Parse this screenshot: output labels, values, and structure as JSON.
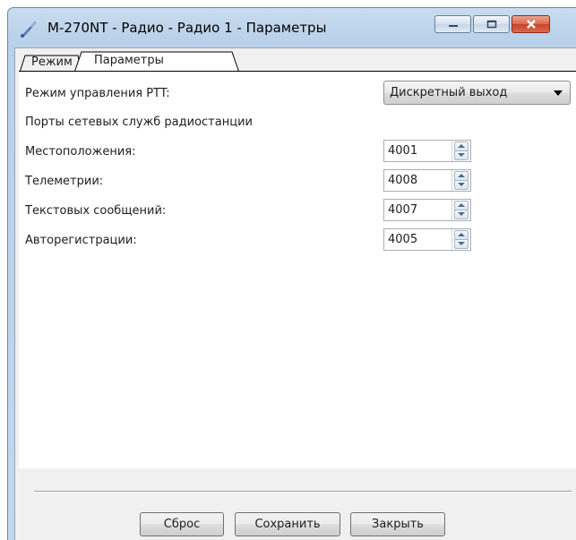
{
  "window": {
    "title": "M-270NT - Радио - Радио 1 - Параметры"
  },
  "tabs": [
    {
      "label": "Режим"
    },
    {
      "label": "Параметры"
    }
  ],
  "form": {
    "ptt_label": "Режим управления PTT:",
    "ptt_value": "Дискретный выход",
    "ports_heading": "Порты сетевых служб радиостанции",
    "location_label": "Местоположения:",
    "location_value": "4001",
    "telemetry_label": "Телеметрии:",
    "telemetry_value": "4008",
    "text_label": "Текстовых сообщений:",
    "text_value": "4007",
    "autoreg_label": "Авторегистрации:",
    "autoreg_value": "4005"
  },
  "buttons": {
    "reset": "Сброс",
    "save": "Сохранить",
    "close": "Закрыть"
  },
  "colors": {
    "frame": "#b9d1ea",
    "close_button": "#c7432a"
  }
}
